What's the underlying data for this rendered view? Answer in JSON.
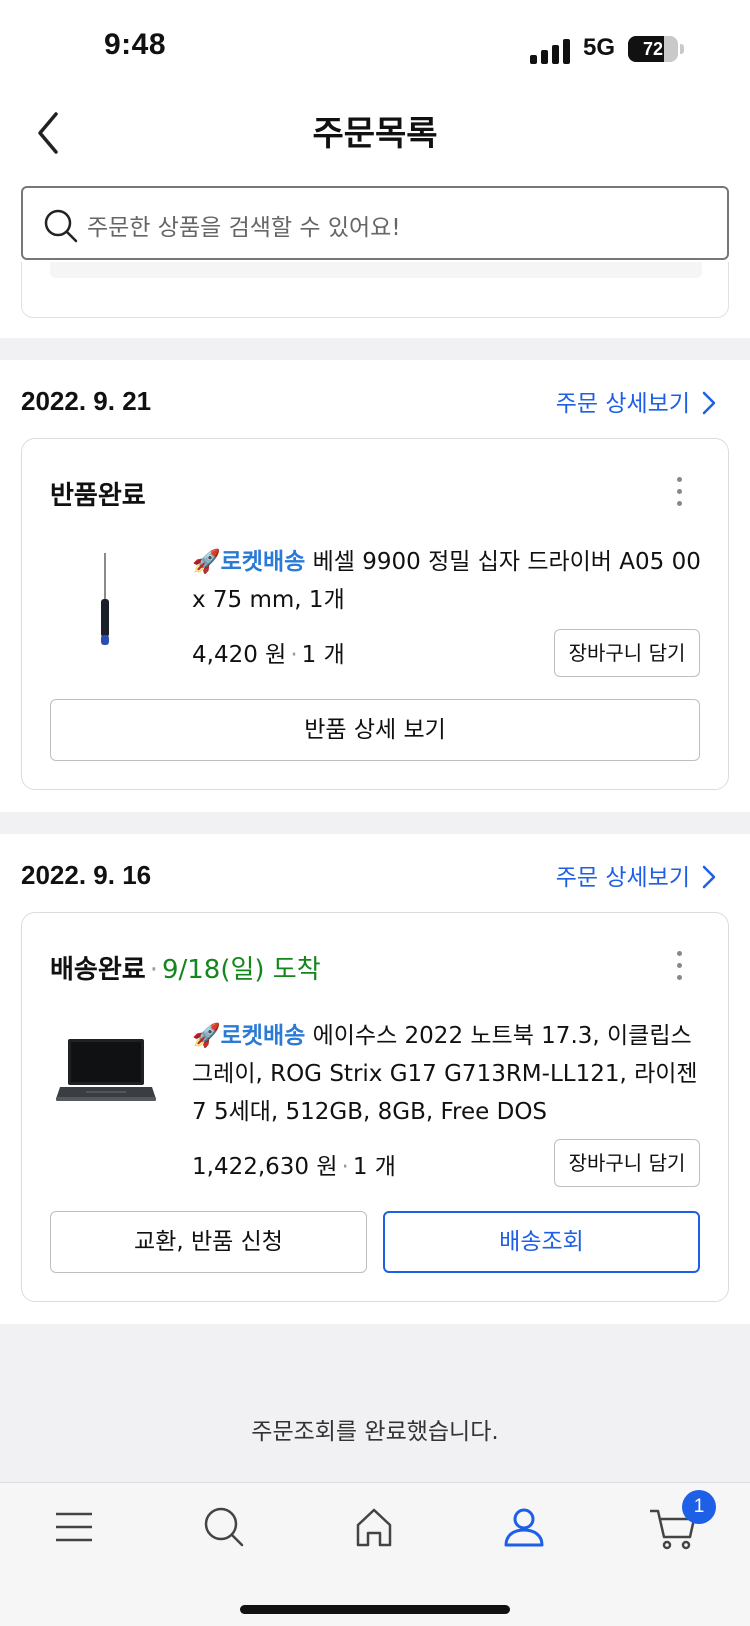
{
  "status_bar": {
    "time": "9:48",
    "network": "5G",
    "battery": "72",
    "battery_level": 0.72
  },
  "header": {
    "title": "주문목록"
  },
  "search": {
    "placeholder": "주문한 상품을 검색할 수 있어요!"
  },
  "orders": [
    {
      "date": "2022. 9. 21",
      "detail_link": "주문 상세보기",
      "status": "반품완료",
      "product": {
        "badge": "로켓배송",
        "name": " 베셀 9900 정밀 십자 드라이버 A05 00 x 75 mm, 1개",
        "price": "4,420 원",
        "quantity": "1 개",
        "image_icon": "screwdriver-image"
      },
      "cart_button": "장바구니 담기",
      "actions": [
        "반품 상세 보기"
      ]
    },
    {
      "date": "2022. 9. 16",
      "detail_link": "주문 상세보기",
      "status": "배송완료",
      "arrival": "9/18(일) 도착",
      "product": {
        "badge": "로켓배송",
        "name": " 에이수스 2022 노트북 17.3, 이클립스 그레이, ROG Strix G17 G713RM-LL121, 라이젠7 5세대, 512GB, 8GB, Free DOS",
        "price": "1,422,630 원",
        "quantity": "1 개",
        "image_icon": "laptop-image"
      },
      "cart_button": "장바구니 담기",
      "actions": [
        "교환, 반품 신청",
        "배송조회"
      ]
    }
  ],
  "footer_message": "주문조회를 완료했습니다.",
  "tabbar": {
    "items": [
      "menu-icon",
      "search-icon",
      "home-icon",
      "my-page-icon",
      "cart-icon"
    ],
    "active": "my-page-icon",
    "cart_count": "1"
  },
  "colors": {
    "accent": "#1d5fe6",
    "arrival_green": "#15851d",
    "rocket_blue": "#2a7ad6"
  }
}
